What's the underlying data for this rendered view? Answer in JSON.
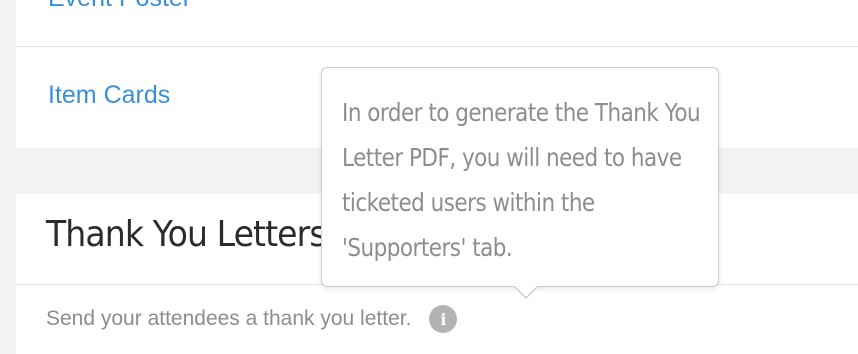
{
  "links": {
    "event_poster": "Event Poster",
    "item_cards": "Item Cards"
  },
  "thank_you_section": {
    "title": "Thank You Letters",
    "description": "Send your attendees a thank you letter.",
    "info_icon_glyph": "i"
  },
  "tooltip": {
    "text": "In order to generate the Thank You Letter PDF, you will need to have ticketed users within the 'Supporters' tab."
  },
  "colors": {
    "link": "#3a8fd8",
    "background": "#f2f2f2",
    "muted_text": "#8d8d8d"
  },
  "icons": {
    "info": "info-icon"
  }
}
